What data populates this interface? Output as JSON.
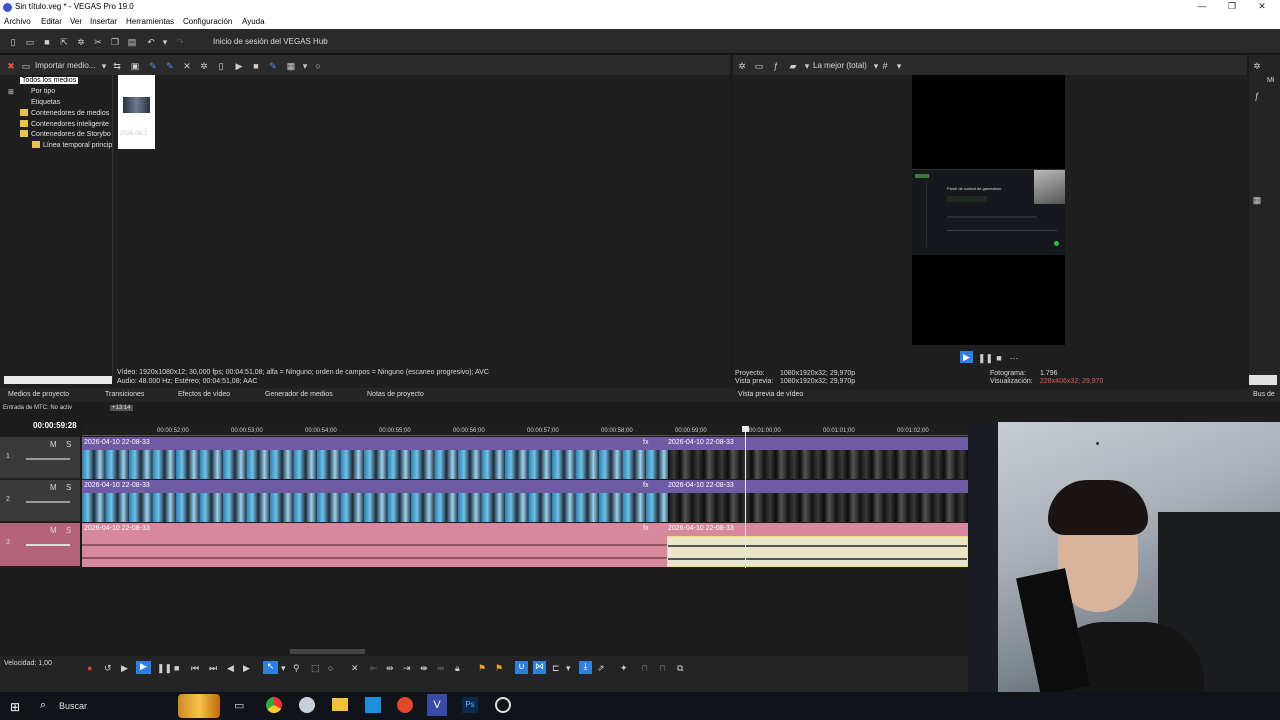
{
  "window": {
    "title": "Sin título.veg * - VEGAS Pro 19.0",
    "minimize": "—",
    "maximize": "❐",
    "close": "✕"
  },
  "menu": [
    "Archivo",
    "Editar",
    "Ver",
    "Insertar",
    "Herramientas",
    "Configuración",
    "Ayuda"
  ],
  "toolbar": {
    "hub_label": "Inicio de sesión del VEGAS Hub"
  },
  "media": {
    "import_label": "Importar medio...",
    "tree": [
      "Todos los medios",
      "Por tipo",
      "Etiquetas",
      "Contenedores de medios",
      "Contenedores inteligente",
      "Contenedores de Storybo",
      "Línea temporal princip"
    ],
    "thumb_date": "2026-04-1",
    "info_line1": "Vídeo: 1920x1080x12; 30,000 fps; 00:04:51,08; alfa = Ninguno; orden de campos = Ninguno (escaneo progresivo); AVC",
    "info_line2": "Audio: 48.000 Hz; Estéreo; 00:04:51,08; AAC"
  },
  "tabs": [
    "Medios de proyecto",
    "Transiciones",
    "Efectos de vídeo",
    "Generador de medios",
    "Notas de proyecto"
  ],
  "preview": {
    "quality": "La mejor (total)",
    "tab_label": "Vista previa de vídeo",
    "proyecto_label": "Proyecto:",
    "proyecto_val": "1080x1920x32; 29,970p",
    "vista_label": "Vista previa:",
    "vista_val": "1080x1920x32; 29,970p",
    "fotograma_label": "Fotograma:",
    "fotograma_val": "1.796",
    "visualizacion_label": "Visualización:",
    "visualizacion_val": "228x406x32; 29,970",
    "screen_title": "Panel de control de gamesbox"
  },
  "right_panel": {
    "top_label": "Mi",
    "tab": "Bus de"
  },
  "timeline": {
    "mtc_label": "Entrada de MTC: No activ",
    "current_time": "00:00:59:28",
    "marker": "+13:14",
    "ruler": [
      "00:00:52;00",
      "00:00:53;00",
      "00:00:54;00",
      "00:00:55;00",
      "00:00:56;00",
      "00:00:57;00",
      "00:00:58;00",
      "00:00:59;00",
      "00:01:00;00",
      "00:01:01;00",
      "00:01:02;00"
    ],
    "tracks": [
      {
        "num": "1",
        "m": "M",
        "s": "S",
        "clip1": "2026-04-10 22-08-33",
        "clip2": "2026-04-10 22-08-33"
      },
      {
        "num": "2",
        "m": "M",
        "s": "S",
        "clip1": "2026-04-10 22-08-33",
        "clip2": "2026-04-10 22-08-33"
      },
      {
        "num": "3",
        "m": "M",
        "s": "S",
        "clip1": "2026-04-10 22-08-33",
        "clip2": "2026-04-10 22-08-33"
      }
    ],
    "fx": "fx",
    "rate_label": "Velocidad: 1,00"
  },
  "taskbar": {
    "search": "Buscar"
  },
  "colors": {
    "video_track": "#6f5ba4",
    "audio_track": "#d7879e",
    "accent": "#2f7fe0"
  }
}
